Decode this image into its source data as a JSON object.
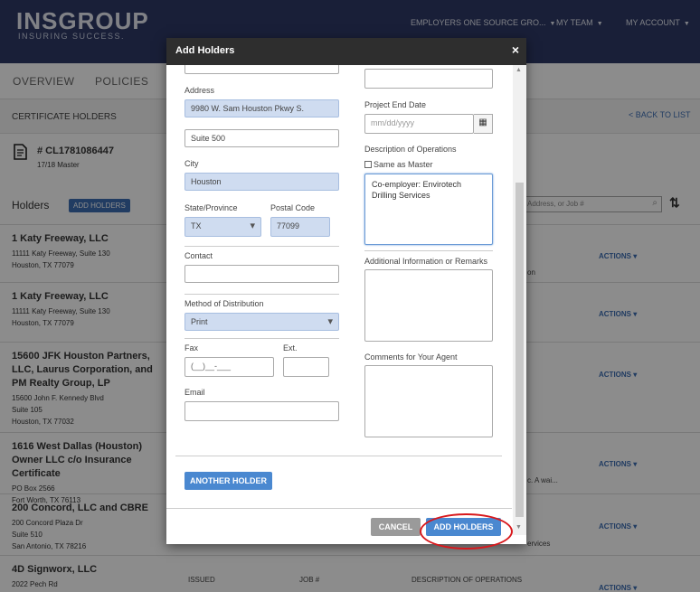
{
  "header": {
    "logo": "INSGROUP",
    "tagline": "INSURING SUCCESS.",
    "nav": [
      "EMPLOYERS ONE SOURCE GRO...",
      "MY TEAM",
      "MY ACCOUNT"
    ]
  },
  "subnav": {
    "overview": "OVERVIEW",
    "policies": "POLICIES"
  },
  "crumb": {
    "title": "CERTIFICATE HOLDERS",
    "back": "< BACK TO LIST"
  },
  "certificate": {
    "number": "# CL1781086447",
    "sub": "17/18 Master"
  },
  "holders": {
    "title": "Holders",
    "add_button": "ADD HOLDERS",
    "search_placeholder": "Address, or Job #",
    "rows": [
      {
        "name": "1 Katy Freeway, LLC",
        "address": [
          "11111 Katy Freeway, Suite 130",
          "Houston, TX 77079"
        ],
        "actions": "ACTIONS",
        "extra": "on"
      },
      {
        "name": "1 Katy Freeway, LLC",
        "address": [
          "11111 Katy Freeway, Suite 130",
          "Houston, TX 77079"
        ],
        "actions": "ACTIONS",
        "extra": ""
      },
      {
        "name": "15600 JFK Houston Partners, LLC, Laurus Corporation, and PM Realty Group, LP",
        "address": [
          "15600 John F. Kennedy Blvd",
          "Suite 105",
          "Houston, TX 77032"
        ],
        "actions": "ACTIONS",
        "extra": ""
      },
      {
        "name": "1616 West Dallas (Houston) Owner LLC c/o Insurance Certificate",
        "address": [
          "PO Box 2566",
          "Fort Worth, TX 76113"
        ],
        "actions": "ACTIONS",
        "extra": "c.  A wai..."
      },
      {
        "name": "200 Concord, LLC and CBRE",
        "address": [
          "200 Concord Plaza Dr",
          "Suite 510",
          "San Antonio, TX 78216"
        ],
        "actions": "ACTIONS",
        "extra": "ervices"
      },
      {
        "name": "4D Signworx, LLC",
        "address": [
          "2022 Pech Rd"
        ],
        "actions": "ACTIONS",
        "extra": ""
      }
    ],
    "bottom_cols": {
      "issued": "ISSUED",
      "job": "JOB #",
      "desc": "DESCRIPTION OF OPERATIONS"
    }
  },
  "modal": {
    "title": "Add Holders",
    "close": "×",
    "left": {
      "address_label": "Address",
      "address1": "9980 W. Sam Houston Pkwy S.",
      "address2": "Suite 500",
      "city_label": "City",
      "city": "Houston",
      "state_label": "State/Province",
      "state": "TX",
      "postal_label": "Postal Code",
      "postal": "77099",
      "contact_label": "Contact",
      "contact": "",
      "method_label": "Method of Distribution",
      "method": "Print",
      "fax_label": "Fax",
      "fax": "(__)__-___",
      "ext_label": "Ext.",
      "email_label": "Email"
    },
    "right": {
      "project_end_label": "Project End Date",
      "project_end_placeholder": "mm/dd/yyyy",
      "desc_label": "Description of Operations",
      "same_as_master": "Same as Master",
      "desc_text": "Co-employer: Envirotech Drilling Services",
      "additional_label": "Additional Information or Remarks",
      "comments_label": "Comments for Your Agent"
    },
    "another_holder": "ANOTHER HOLDER",
    "cancel": "CANCEL",
    "add_holders": "ADD HOLDERS"
  },
  "colors": {
    "brand_navy": "#2e3a66",
    "primary_blue": "#4a88d0",
    "annotation_red": "#d8181c"
  }
}
